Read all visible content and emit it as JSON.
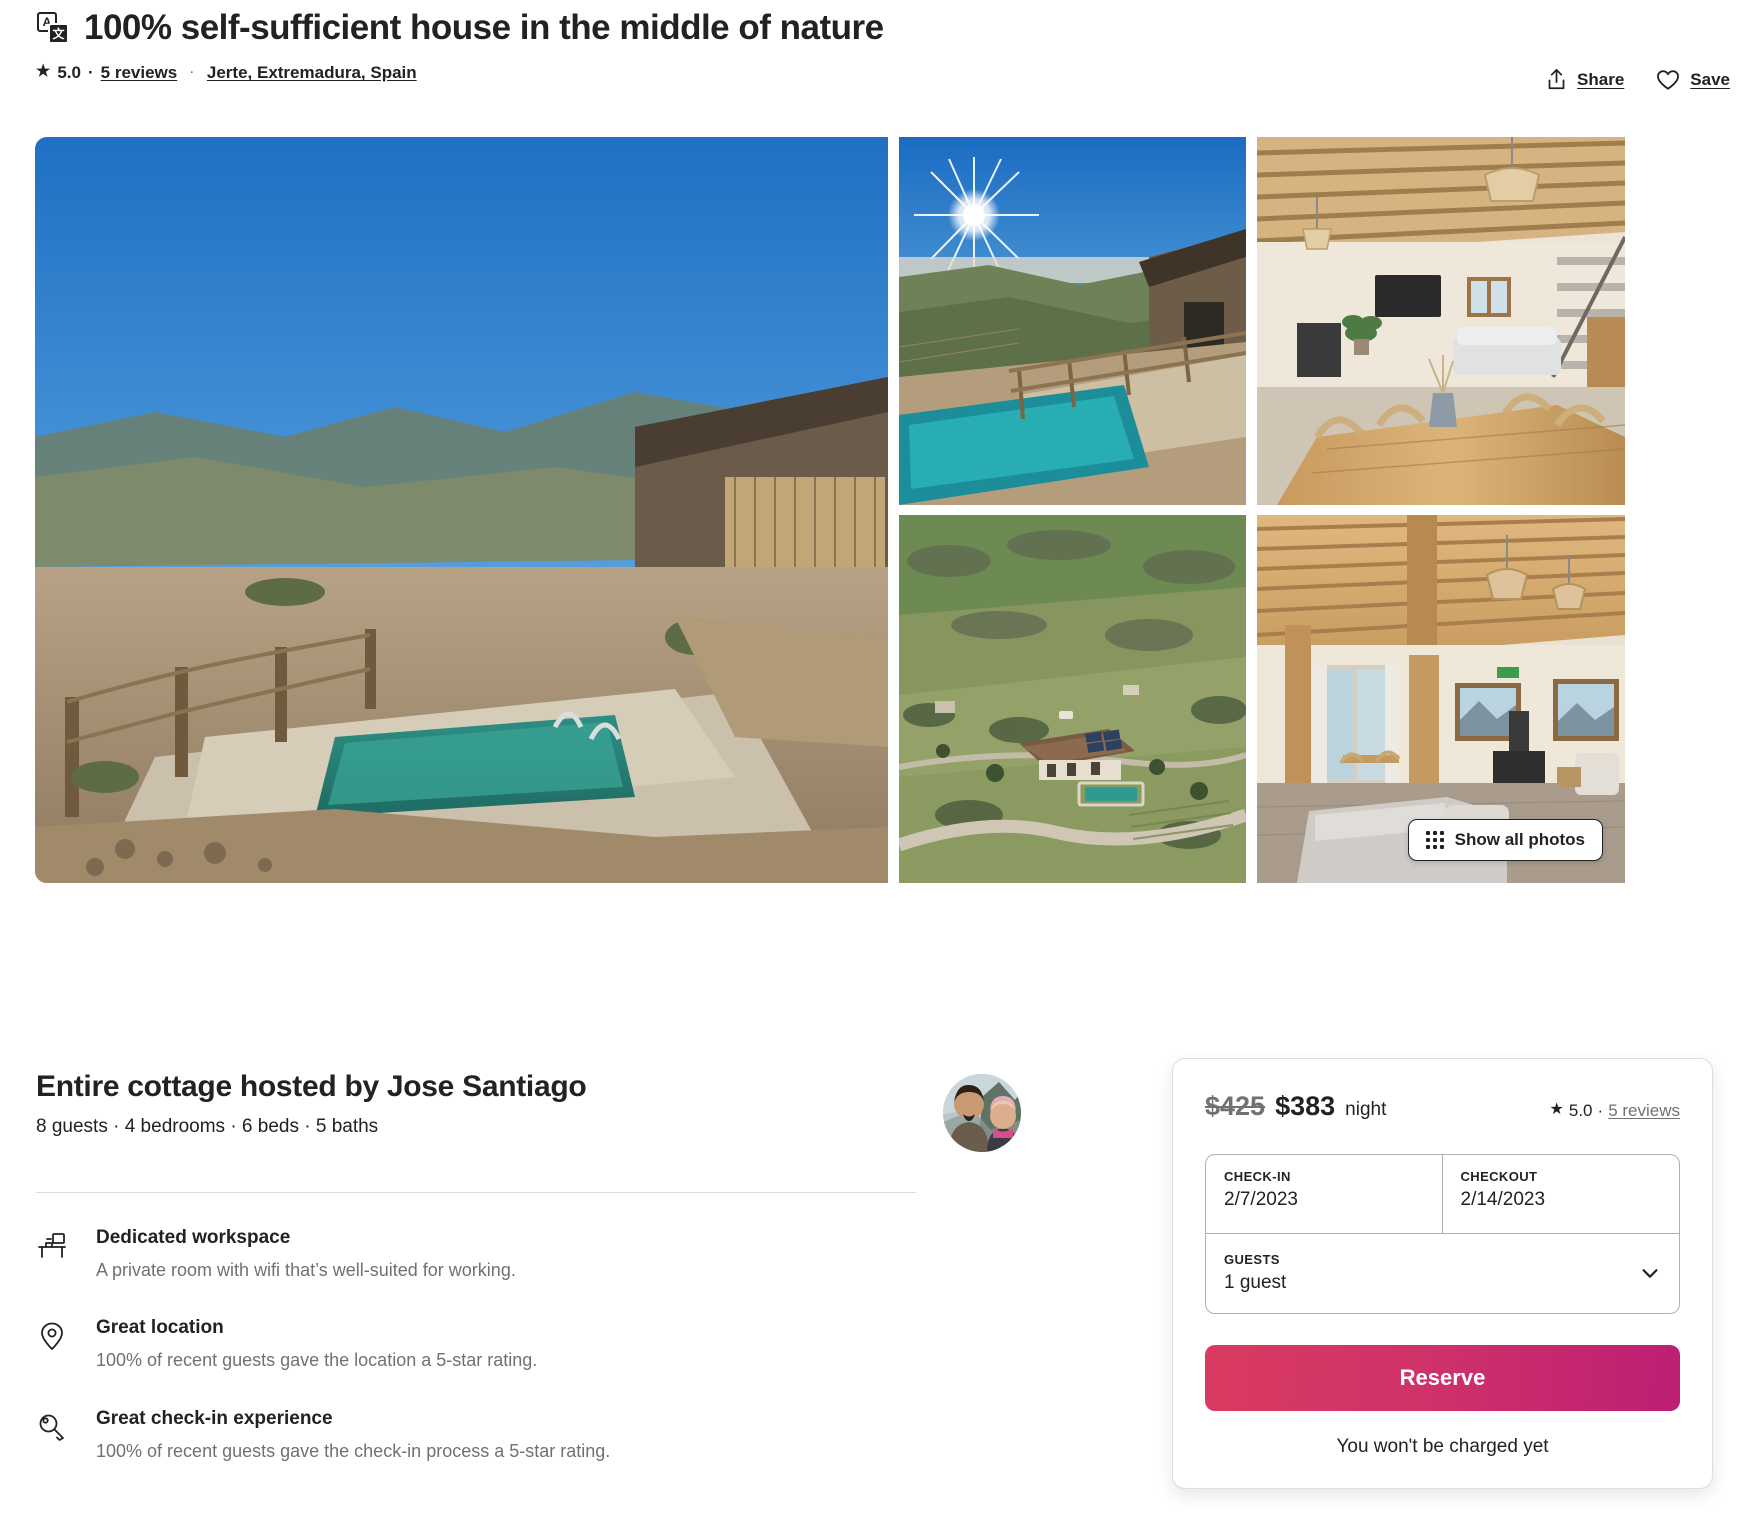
{
  "header": {
    "translate_icon": "translate-icon",
    "title": "100% self-sufficient house in the middle of nature",
    "rating": "5.0",
    "reviews_link": "5 reviews",
    "separator": "·",
    "location": "Jerte, Extremadura, Spain",
    "share_label": "Share",
    "save_label": "Save",
    "share_icon": "share-upload-icon",
    "save_icon": "heart-icon"
  },
  "gallery": {
    "photos": [
      {
        "name": "pool-terrace-exterior",
        "alt": "Outdoor pool and stone cottage on hillside"
      },
      {
        "name": "pool-sunburst-view",
        "alt": "Pool with sun flare over mountain valley"
      },
      {
        "name": "living-dining-room",
        "alt": "Open-plan dining table and living room with wood beams"
      },
      {
        "name": "aerial-house-landscape",
        "alt": "Aerial view of house with solar panels in green valley"
      },
      {
        "name": "living-room-fireplace",
        "alt": "Living room with wood stove and mountain view"
      }
    ],
    "show_all_label": "Show all photos",
    "show_all_icon": "grid-dots-icon"
  },
  "host": {
    "heading": "Entire cottage hosted by Jose Santiago",
    "details": "8 guests · 4 bedrooms · 6 beds · 5 baths",
    "avatar_name": "host-avatar"
  },
  "highlights": [
    {
      "icon": "desk-workspace-icon",
      "title": "Dedicated workspace",
      "description": "A private room with wifi that’s well-suited for working."
    },
    {
      "icon": "map-pin-icon",
      "title": "Great location",
      "description": "100% of recent guests gave the location a 5-star rating."
    },
    {
      "icon": "key-icon",
      "title": "Great check-in experience",
      "description": "100% of recent guests gave the check-in process a 5-star rating."
    }
  ],
  "booking": {
    "price_original": "$425",
    "price_current": "$383",
    "price_unit": "night",
    "rating": "5.0",
    "rating_separator": "·",
    "reviews_link": "5 reviews",
    "checkin_label": "CHECK-IN",
    "checkin_value": "2/7/2023",
    "checkout_label": "CHECKOUT",
    "checkout_value": "2/14/2023",
    "guests_label": "GUESTS",
    "guests_value": "1 guest",
    "guests_chevron_icon": "chevron-down-icon",
    "reserve_label": "Reserve",
    "charge_note": "You won't be charged yet"
  },
  "colors": {
    "reserve_gradient_start": "#d93b5f",
    "reserve_gradient_end": "#bd1e73",
    "text_primary": "#222222",
    "text_muted": "#717171",
    "border": "#dddddd"
  }
}
